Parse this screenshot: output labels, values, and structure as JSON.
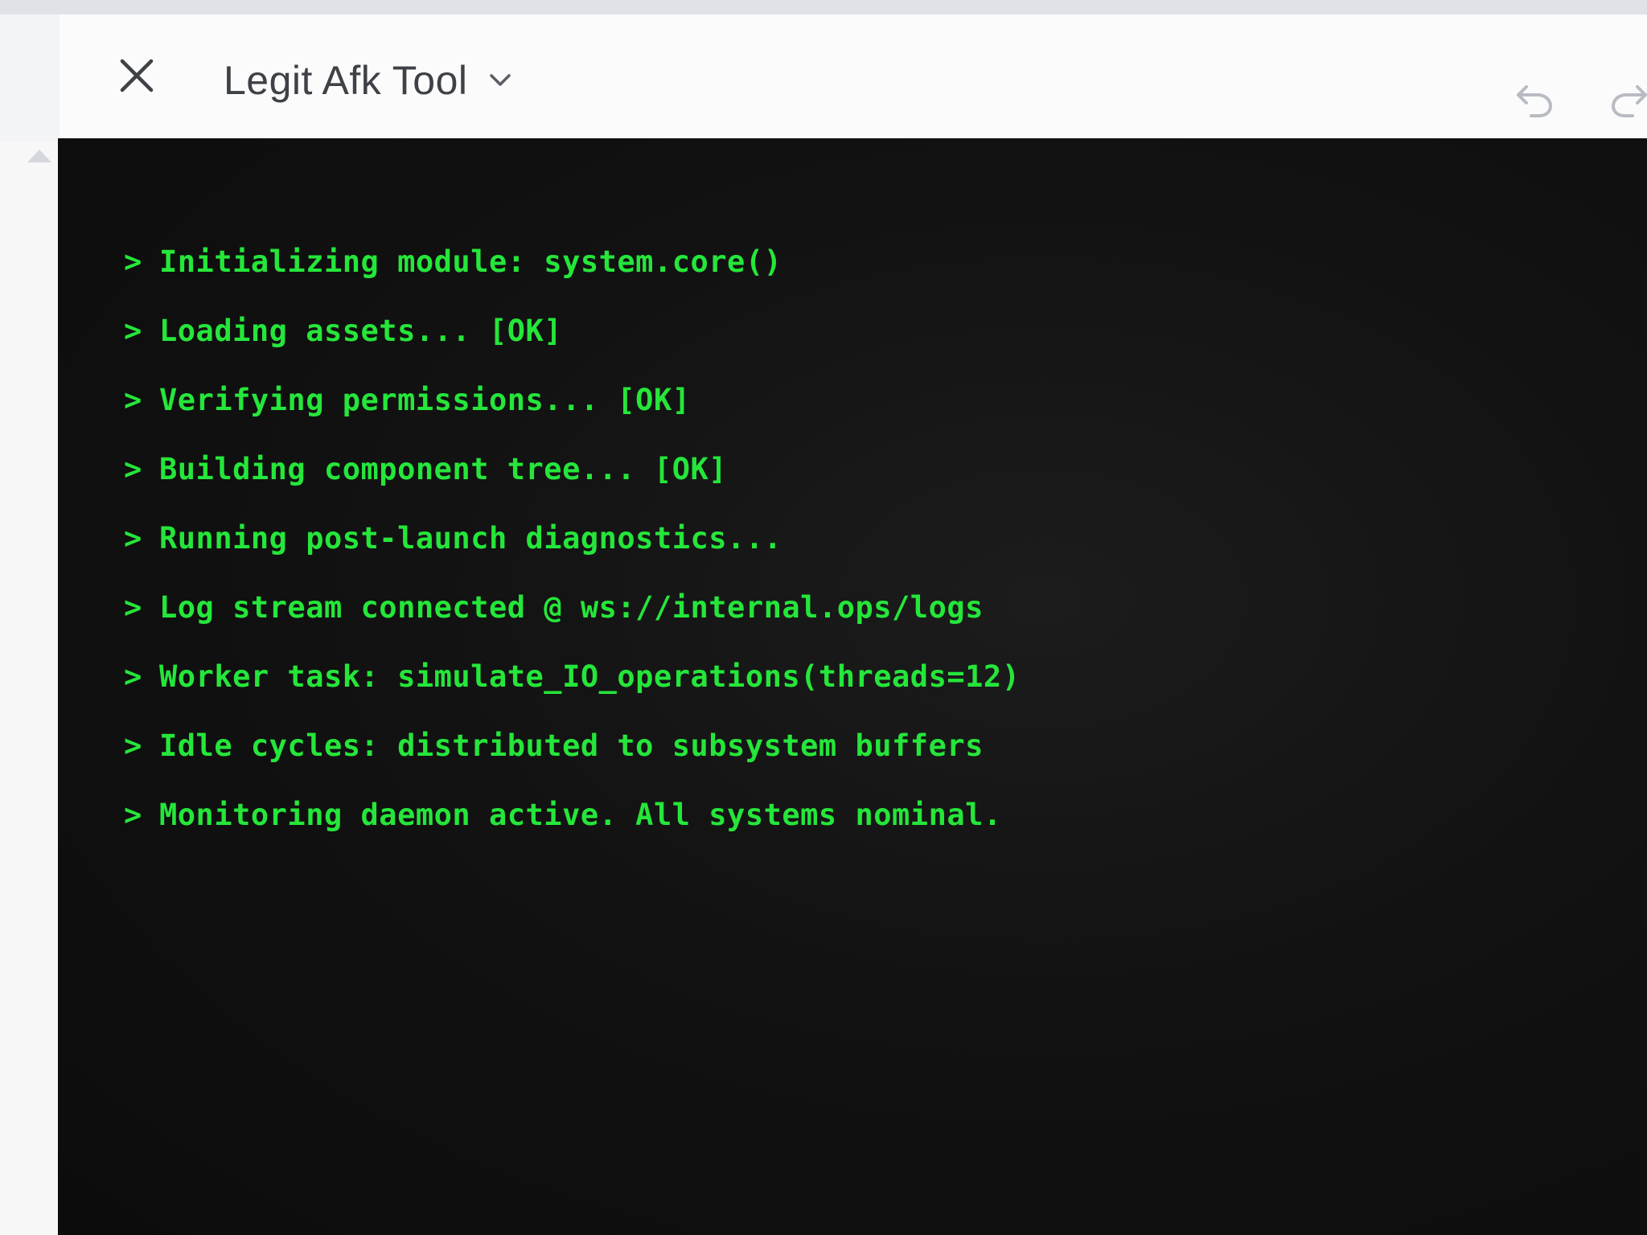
{
  "window": {
    "title": "Legit Afk Tool"
  },
  "icons": {
    "close": "close-icon",
    "dropdown": "chevron-down-icon",
    "undo": "undo-icon",
    "redo": "redo-icon"
  },
  "colors": {
    "terminal_background": "#121212",
    "terminal_text": "#25e63a",
    "titlebar_background": "#fbfbfc",
    "title_text": "#3e4146"
  },
  "terminal": {
    "prompt": ">",
    "lines": [
      "Initializing module: system.core()",
      "Loading assets... [OK]",
      "Verifying permissions... [OK]",
      "Building component tree... [OK]",
      "Running post-launch diagnostics...",
      "Log stream connected @ ws://internal.ops/logs",
      "Worker task: simulate_IO_operations(threads=12)",
      "Idle cycles: distributed to subsystem buffers",
      "Monitoring daemon active. All systems nominal."
    ]
  }
}
